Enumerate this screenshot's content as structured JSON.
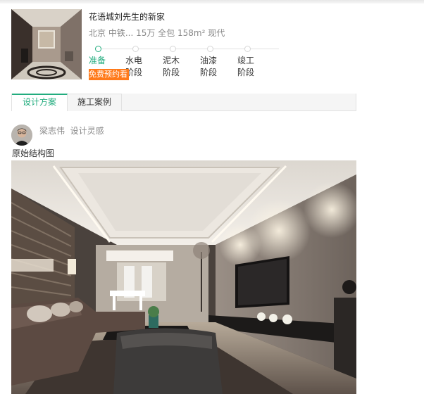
{
  "project": {
    "title": "花语城刘先生的新家",
    "meta": "北京 中铁... 15万 全包 158m² 现代"
  },
  "stages": [
    {
      "line1": "准备",
      "line2": "",
      "active": true
    },
    {
      "line1": "水电",
      "line2": "阶段",
      "active": false
    },
    {
      "line1": "泥木",
      "line2": "阶段",
      "active": false
    },
    {
      "line1": "油漆",
      "line2": "阶段",
      "active": false
    },
    {
      "line1": "竣工",
      "line2": "阶段",
      "active": false
    }
  ],
  "free_button": "免费预约看",
  "tabs": [
    {
      "label": "设计方案",
      "active": true
    },
    {
      "label": "施工案例",
      "active": false
    }
  ],
  "author": {
    "name": "梁志伟",
    "tag": "设计灵感"
  },
  "section_label": "原始结构图",
  "colors": {
    "accent": "#22ac7e",
    "orange": "#ff7a1a"
  }
}
